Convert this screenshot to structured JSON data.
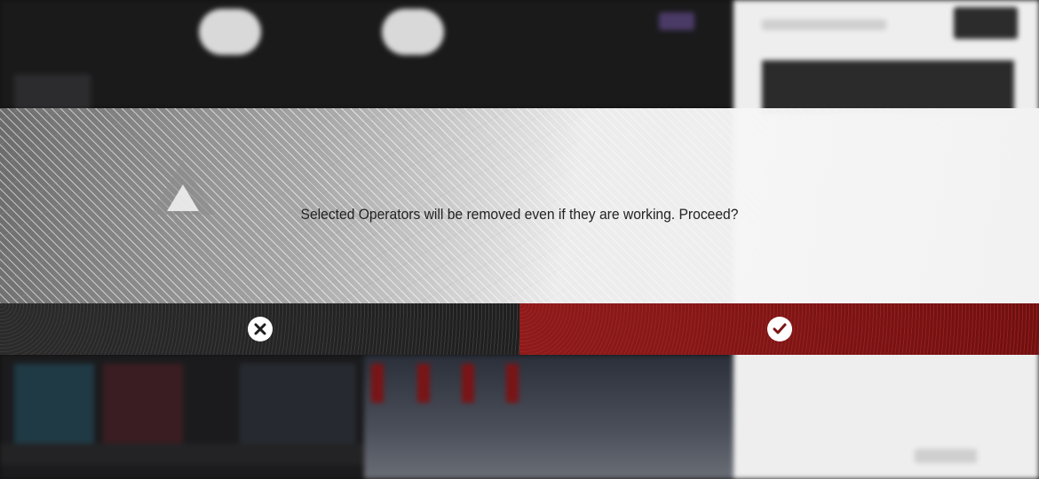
{
  "dialog": {
    "message": "Selected Operators will be removed even if they are working. Proceed?",
    "cancel_icon": "close-icon",
    "confirm_icon": "checkmark-icon"
  },
  "colors": {
    "confirm_bg": "#7d1414",
    "cancel_bg": "#222222",
    "panel_bg": "#f2f2f2"
  }
}
